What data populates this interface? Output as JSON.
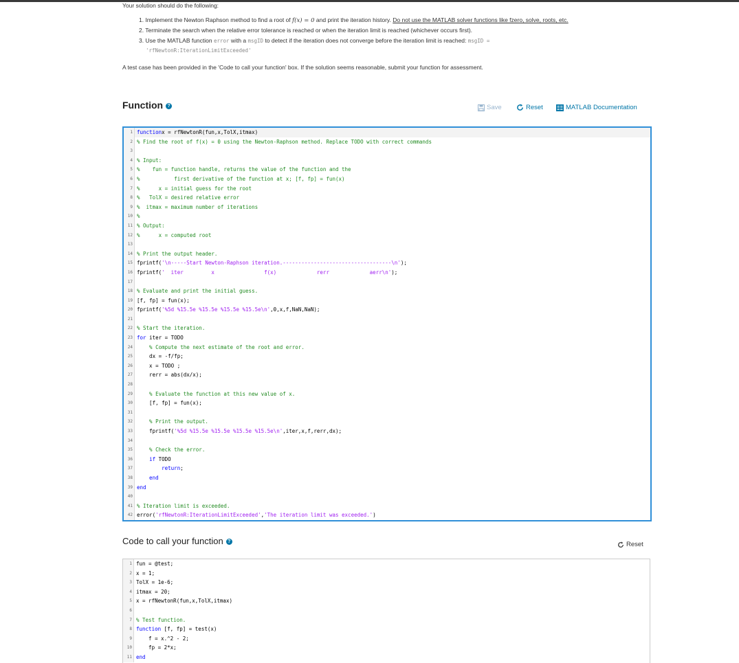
{
  "intro": {
    "lead": "Your solution should do the following:",
    "item1_pre": "1. Implement the Newton Raphson method to find a root of ",
    "item1_math": "f(x) = 0",
    "item1_mid": " and print the iteration history. ",
    "item1_link": "Do not use the MATLAB solver functions like fzero, solve, roots, etc.",
    "item2": "2. Terminate the search when the relative error tolerance is reached or when the iteration limit is reached (whichever occurs first).",
    "item3_pre": "3. Use the MATLAB function ",
    "item3_code": "error",
    "item3_mid": " with a ",
    "item3_code2": "msgID",
    "item3_post": " to detect if the iteration does not converge before the iteration limit is reached: ",
    "item3_code3": "msgID =",
    "item3_code4": "'rfNewtonR:IterationLimitExceeded'",
    "testcase": "A test case has been provided in the 'Code to call your function' box. If the solution seems reasonable, submit your function for assessment."
  },
  "function_section": {
    "title": "Function",
    "help_glyph": "?",
    "save_label": "Save",
    "reset_label": "Reset",
    "docs_label": "MATLAB Documentation"
  },
  "function_code": [
    {
      "n": "1",
      "parts": [
        [
          "kw",
          "function"
        ],
        [
          "",
          "x = rfNewtonR(fun,x,TolX,itmax)"
        ]
      ]
    },
    {
      "n": "2",
      "parts": [
        [
          "cm",
          "% Find the root of f(x) = 0 using the Newton-Raphson method. Replace TODO with correct commands"
        ]
      ]
    },
    {
      "n": "3",
      "parts": []
    },
    {
      "n": "4",
      "parts": [
        [
          "cm",
          "% Input:"
        ]
      ]
    },
    {
      "n": "5",
      "parts": [
        [
          "cm",
          "%    fun = function handle, returns the value of the function and the"
        ]
      ]
    },
    {
      "n": "6",
      "parts": [
        [
          "cm",
          "%           first derivative of the function at x; [f, fp] = fun(x)"
        ]
      ]
    },
    {
      "n": "7",
      "parts": [
        [
          "cm",
          "%      x = initial guess for the root"
        ]
      ]
    },
    {
      "n": "8",
      "parts": [
        [
          "cm",
          "%   TolX = desired relative error"
        ]
      ]
    },
    {
      "n": "9",
      "parts": [
        [
          "cm",
          "%  itmax = maximum number of iterations"
        ]
      ]
    },
    {
      "n": "10",
      "parts": [
        [
          "cm",
          "%"
        ]
      ]
    },
    {
      "n": "11",
      "parts": [
        [
          "cm",
          "% Output:"
        ]
      ]
    },
    {
      "n": "12",
      "parts": [
        [
          "cm",
          "%      x = computed root"
        ]
      ]
    },
    {
      "n": "13",
      "parts": []
    },
    {
      "n": "14",
      "parts": [
        [
          "cm",
          "% Print the output header."
        ]
      ]
    },
    {
      "n": "15",
      "parts": [
        [
          "",
          "fprintf("
        ],
        [
          "st",
          "'\\n-----Start Newton-Raphson iteration.-----------------------------------\\n'"
        ],
        [
          "",
          ");"
        ]
      ]
    },
    {
      "n": "16",
      "parts": [
        [
          "",
          "fprintf("
        ],
        [
          "st",
          "'  iter         x                f(x)             rerr             aerr\\n'"
        ],
        [
          "",
          ");"
        ]
      ]
    },
    {
      "n": "17",
      "parts": []
    },
    {
      "n": "18",
      "parts": [
        [
          "cm",
          "% Evaluate and print the initial guess."
        ]
      ]
    },
    {
      "n": "19",
      "parts": [
        [
          "",
          "[f, fp] = fun(x);"
        ]
      ]
    },
    {
      "n": "20",
      "parts": [
        [
          "",
          "fprintf("
        ],
        [
          "st",
          "'%5d %15.5e %15.5e %15.5e %15.5e\\n'"
        ],
        [
          "",
          ",0,x,f,NaN,NaN);"
        ]
      ]
    },
    {
      "n": "21",
      "parts": []
    },
    {
      "n": "22",
      "parts": [
        [
          "cm",
          "% Start the iteration."
        ]
      ]
    },
    {
      "n": "23",
      "parts": [
        [
          "kw",
          "for"
        ],
        [
          "",
          " iter = TODO"
        ]
      ]
    },
    {
      "n": "24",
      "parts": [
        [
          "cm",
          "    % Compute the next estimate of the root and error."
        ]
      ]
    },
    {
      "n": "25",
      "parts": [
        [
          "",
          "    dx = -f/fp;"
        ]
      ]
    },
    {
      "n": "26",
      "parts": [
        [
          "",
          "    x = TODO ;"
        ]
      ]
    },
    {
      "n": "27",
      "parts": [
        [
          "",
          "    rerr = abs(dx/x);"
        ]
      ]
    },
    {
      "n": "28",
      "parts": []
    },
    {
      "n": "29",
      "parts": [
        [
          "cm",
          "    % Evaluate the function at this new value of x."
        ]
      ]
    },
    {
      "n": "30",
      "parts": [
        [
          "",
          "    [f, fp] = fun(x);"
        ]
      ]
    },
    {
      "n": "31",
      "parts": []
    },
    {
      "n": "32",
      "parts": [
        [
          "cm",
          "    % Print the output."
        ]
      ]
    },
    {
      "n": "33",
      "parts": [
        [
          "",
          "    fprintf("
        ],
        [
          "st",
          "'%5d %15.5e %15.5e %15.5e %15.5e\\n'"
        ],
        [
          "",
          ",iter,x,f,rerr,dx);"
        ]
      ]
    },
    {
      "n": "34",
      "parts": []
    },
    {
      "n": "35",
      "parts": [
        [
          "cm",
          "    % Check the error."
        ]
      ]
    },
    {
      "n": "36",
      "parts": [
        [
          "",
          "    "
        ],
        [
          "kw",
          "if"
        ],
        [
          "",
          " TODO"
        ]
      ]
    },
    {
      "n": "37",
      "parts": [
        [
          "kw",
          "        return"
        ],
        [
          "",
          ";"
        ]
      ]
    },
    {
      "n": "38",
      "parts": [
        [
          "kw",
          "    end"
        ]
      ]
    },
    {
      "n": "39",
      "parts": [
        [
          "kw",
          "end"
        ]
      ]
    },
    {
      "n": "40",
      "parts": []
    },
    {
      "n": "41",
      "parts": [
        [
          "cm",
          "% Iteration limit is exceeded."
        ]
      ]
    },
    {
      "n": "42",
      "parts": [
        [
          "",
          "error("
        ],
        [
          "st",
          "'rfNewtonR:IterationLimitExceeded'"
        ],
        [
          "",
          ","
        ],
        [
          "st",
          "'The iteration limit was exceeded.'"
        ],
        [
          "",
          ")"
        ]
      ]
    }
  ],
  "call_section": {
    "title": "Code to call your function",
    "help_glyph": "?",
    "reset_label": "Reset"
  },
  "call_code": [
    {
      "n": "1",
      "parts": [
        [
          "",
          "fun = @test;"
        ]
      ]
    },
    {
      "n": "2",
      "parts": [
        [
          "",
          "x = 1;"
        ]
      ]
    },
    {
      "n": "3",
      "parts": [
        [
          "",
          "TolX = 1e-6;"
        ]
      ]
    },
    {
      "n": "4",
      "parts": [
        [
          "",
          "itmax = 20;"
        ]
      ]
    },
    {
      "n": "5",
      "parts": [
        [
          "",
          "x = rfNewtonR(fun,x,TolX,itmax)"
        ]
      ]
    },
    {
      "n": "6",
      "parts": []
    },
    {
      "n": "7",
      "parts": [
        [
          "cm",
          "% Test function."
        ]
      ]
    },
    {
      "n": "8",
      "parts": [
        [
          "kw",
          "function"
        ],
        [
          "",
          " [f, fp] = test(x)"
        ]
      ]
    },
    {
      "n": "9",
      "parts": [
        [
          "",
          "    f = x.^2 - 2;"
        ]
      ]
    },
    {
      "n": "10",
      "parts": [
        [
          "",
          "    fp = 2*x;"
        ]
      ]
    },
    {
      "n": "11",
      "parts": [
        [
          "kw",
          "end"
        ]
      ]
    }
  ],
  "colors": {
    "accent": "#0076a8",
    "editor_focus": "#2f8fd8",
    "keyword": "#0000ff",
    "comment": "#228b22",
    "string": "#a020f0"
  }
}
